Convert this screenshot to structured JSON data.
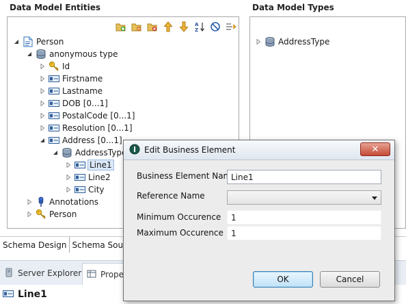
{
  "left_pane": {
    "title": "Data Model Entities",
    "toolbar_icons": [
      "add-entity-icon",
      "add-type-icon",
      "remove-icon",
      "move-up-icon",
      "move-down-icon",
      "sort-az-icon",
      "hide-icon",
      "expand-collapse-icon"
    ],
    "tree": [
      {
        "label": "Person",
        "icon": "document-icon",
        "twisty": "expanded"
      },
      {
        "label": "anonymous type",
        "icon": "type-stack-icon",
        "twisty": "expanded"
      },
      {
        "label": "Id",
        "icon": "key-icon",
        "twisty": "collapsed"
      },
      {
        "label": "Firstname",
        "icon": "element-icon",
        "twisty": "collapsed"
      },
      {
        "label": "Lastname",
        "icon": "element-icon",
        "twisty": "collapsed"
      },
      {
        "label": "DOB  [0...1]",
        "icon": "element-icon",
        "twisty": "collapsed"
      },
      {
        "label": "PostalCode  [0...1]",
        "icon": "element-icon",
        "twisty": "collapsed"
      },
      {
        "label": "Resolution  [0...1]",
        "icon": "element-icon",
        "twisty": "collapsed"
      },
      {
        "label": "Address  [0...1]",
        "icon": "element-icon",
        "twisty": "expanded"
      },
      {
        "label": "AddressType",
        "icon": "type-stack-icon",
        "twisty": "expanded"
      },
      {
        "label": "Line1",
        "icon": "element-icon",
        "twisty": "collapsed",
        "selected": true
      },
      {
        "label": "Line2",
        "icon": "element-icon",
        "twisty": "collapsed"
      },
      {
        "label": "City",
        "icon": "element-icon",
        "twisty": "collapsed"
      },
      {
        "label": "Annotations",
        "icon": "pin-icon",
        "twisty": "collapsed"
      },
      {
        "label": "Person",
        "icon": "key-icon",
        "twisty": "collapsed"
      }
    ]
  },
  "right_pane": {
    "title": "Data Model Types",
    "tree": [
      {
        "label": "AddressType",
        "icon": "type-stack-icon",
        "twisty": "collapsed"
      }
    ]
  },
  "editor_tabs": [
    {
      "label": "Schema Design"
    },
    {
      "label": "Schema Source"
    }
  ],
  "views_bar": {
    "tabs": [
      {
        "label": "Server Explorer",
        "icon": "server-icon"
      },
      {
        "label": "Prope",
        "icon": "properties-icon"
      }
    ]
  },
  "status": {
    "label": "Line1",
    "icon": "element-icon"
  },
  "dialog": {
    "title": "Edit Business Element",
    "close_glyph": "✕",
    "fields": [
      {
        "label": "Business Element Name",
        "value": "Line1",
        "kind": "input"
      },
      {
        "label": "Reference Name",
        "value": "",
        "kind": "select"
      },
      {
        "label": "Minimum Occurence",
        "value": "1",
        "kind": "plain"
      },
      {
        "label": "Maximum Occurence",
        "value": "1",
        "kind": "plain"
      }
    ],
    "ok_label": "OK",
    "cancel_label": "Cancel"
  },
  "colors": {
    "selection": "#dbe8f8",
    "dialog_bg": "#ececec",
    "views_bar_bg": "#e9eef5",
    "close_red": "#c44a36"
  }
}
